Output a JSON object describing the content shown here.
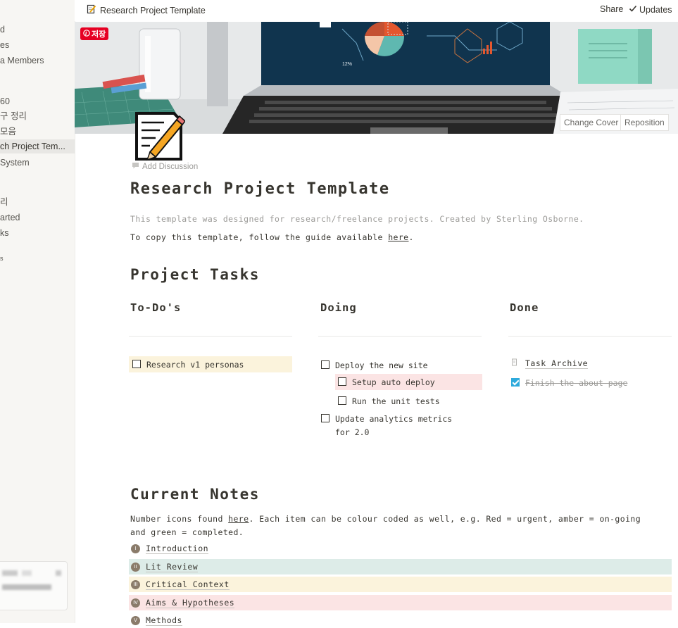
{
  "sidebar": {
    "items": [
      {
        "label": "d"
      },
      {
        "label": "es"
      },
      {
        "label": "a Members"
      },
      {
        "label": "60"
      },
      {
        "label": "구 정리"
      },
      {
        "label": " 모음"
      },
      {
        "label": "ch Project Tem..."
      },
      {
        "label": " System"
      },
      {
        "label": "리"
      },
      {
        "label": "arted"
      },
      {
        "label": "ks"
      },
      {
        "label": "s"
      }
    ],
    "active_index": 6
  },
  "topbar": {
    "breadcrumb": "Research Project Template",
    "share": "Share",
    "updates": "Updates"
  },
  "cover": {
    "pin_label": "저장",
    "change_cover": "Change Cover",
    "reposition": "Reposition",
    "chart_label": "12%"
  },
  "page": {
    "add_discussion": "Add Discussion",
    "title": "Research Project Template",
    "description": "This template was designed for research/freelance projects. Created by Sterling Osborne.",
    "copy_prefix": "To copy this template, follow the guide available ",
    "copy_link": "here",
    "copy_suffix": "."
  },
  "tasks": {
    "heading": "Project Tasks",
    "todo": {
      "heading": "To-Do's",
      "items": [
        {
          "label": "Research v1 personas"
        }
      ]
    },
    "doing": {
      "heading": "Doing",
      "items": [
        {
          "label": "Deploy the new site"
        },
        {
          "label": "Setup auto deploy"
        },
        {
          "label": "Run the unit tests"
        },
        {
          "label": "Update analytics metrics",
          "label2": "for 2.0"
        }
      ]
    },
    "done": {
      "heading": "Done",
      "archive": "Task Archive",
      "items": [
        {
          "label": "Finish the about page",
          "checked": true
        }
      ]
    }
  },
  "notes": {
    "heading": "Current Notes",
    "intro_prefix": "Number icons found ",
    "intro_link": "here",
    "intro_suffix": ". Each item can be colour coded as well, e.g. Red = urgent, amber = on-going",
    "intro_line2": "and green = completed.",
    "items": [
      {
        "num": "I",
        "label": "Introduction",
        "color": ""
      },
      {
        "num": "II",
        "label": "Lit Review",
        "color": "#ddece8"
      },
      {
        "num": "III",
        "label": "Critical Context",
        "color": "#fbf3dc"
      },
      {
        "num": "IV",
        "label": "Aims & Hypotheses",
        "color": "#fbe4e4"
      },
      {
        "num": "V",
        "label": "Methods",
        "color": ""
      }
    ]
  },
  "colors": {
    "todo_bg": "#fbf3dc",
    "red_bg": "#fbe4e4",
    "accent": "#2eaadc"
  }
}
